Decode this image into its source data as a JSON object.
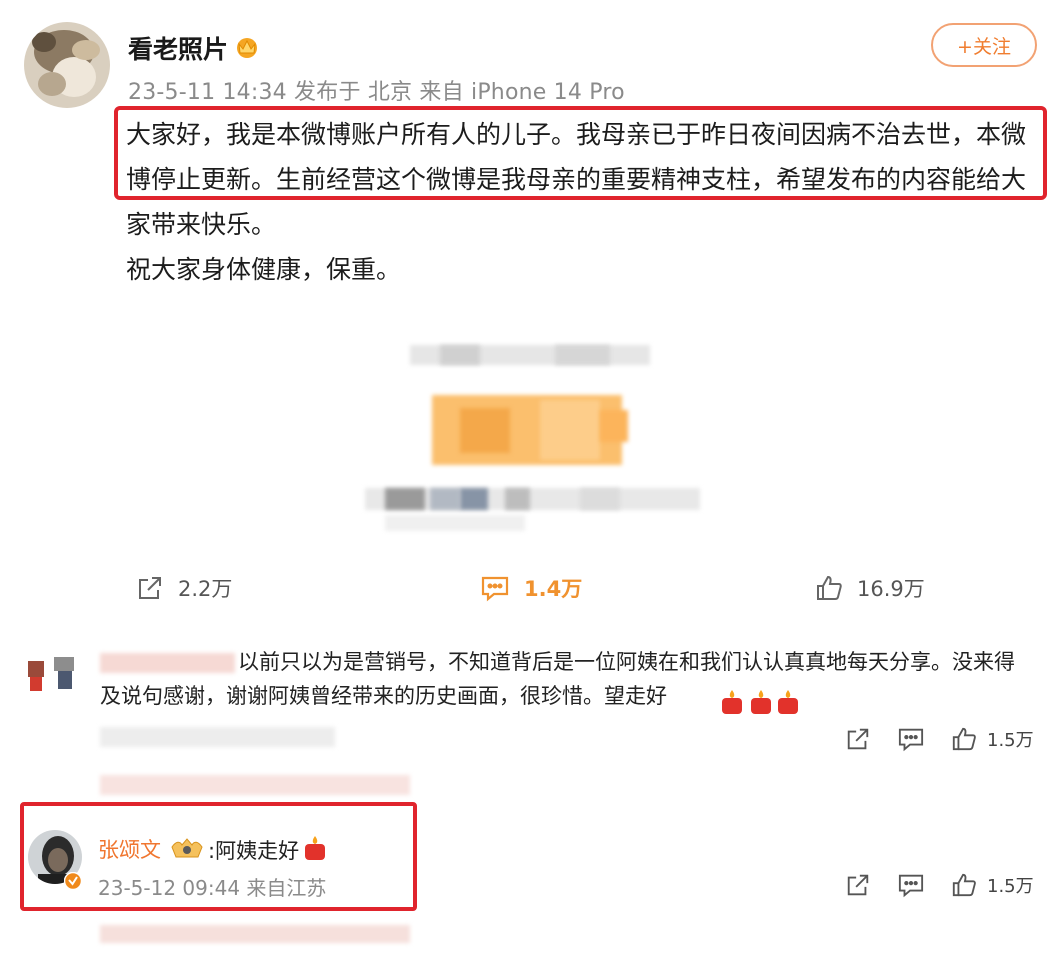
{
  "post": {
    "author_name": "看老照片",
    "meta": "23-5-11 14:34 发布于 北京 来自 iPhone 14 Pro",
    "follow_label": "+关注",
    "paragraphs": [
      "大家好，我是本微博账户所有人的儿子。我母亲已于昨日夜间因病不治去世，本微博停止更新。生前经营这个微博是我母亲的重要精神支柱，希望发布的内容能给大家带来快乐。",
      "祝大家身体健康，保重。"
    ],
    "actions": {
      "repost_count": "2.2万",
      "comment_count": "1.4万",
      "like_count": "16.9万"
    },
    "accent_color": "#f0922f"
  },
  "comments": [
    {
      "text": "以前只以为是营销号，不知道背后是一位阿姨在和我们认认真真地每天分享。没来得及说句感谢，谢谢阿姨曾经带来的历史画面，很珍惜。望走好",
      "like_count": "1.5万"
    },
    {
      "commenter_name": "张颂文",
      "text": ":阿姨走好",
      "meta": "23-5-12 09:44 来自江苏",
      "like_count": "1.5万"
    }
  ],
  "icons": [
    "repost-icon",
    "comment-icon",
    "like-icon",
    "crown-badge-icon",
    "candle-emoji-icon",
    "verified-icon"
  ],
  "highlight_color": "#e0242d"
}
